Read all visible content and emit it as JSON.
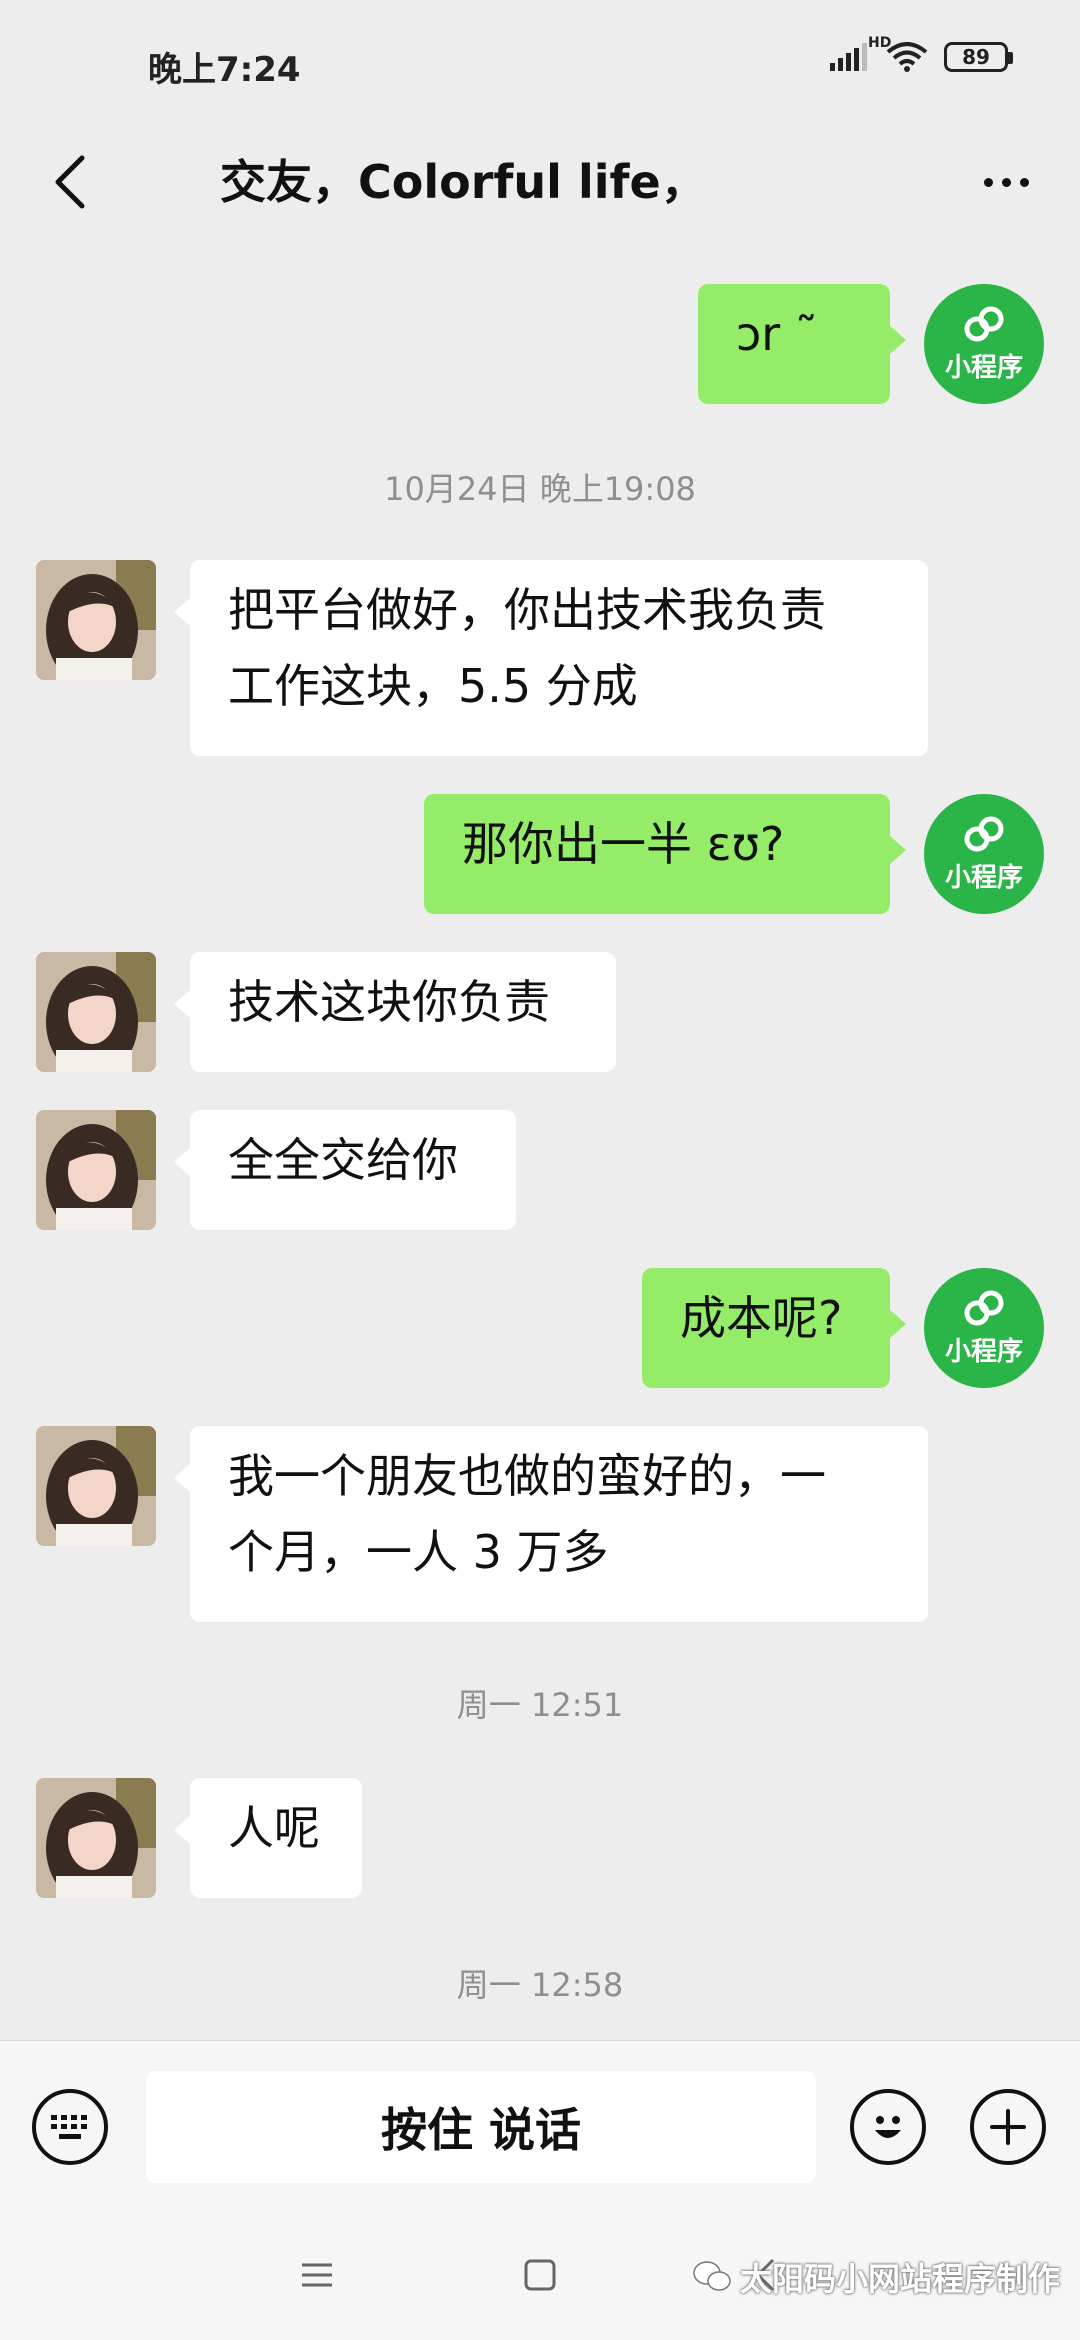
{
  "status_bar": {
    "time": "晚上7:24",
    "network_label": "HD",
    "battery": "89"
  },
  "header": {
    "title": "交友，Colorful life，"
  },
  "messages": [
    {
      "side": "right",
      "text": "ɔr ˜",
      "mini_program_label": "小程序"
    },
    {
      "side": "left",
      "text_lines": [
        "把平台做好，你出技术我负责",
        "工作这块，5.5 分成"
      ]
    },
    {
      "side": "right",
      "text": "那你出一半        ɛʊ?",
      "mini_program_label": "小程序"
    },
    {
      "side": "left",
      "text": "技术这块你负责"
    },
    {
      "side": "left",
      "text": "全全交给你"
    },
    {
      "side": "right",
      "text": "成本呢?",
      "mini_program_label": "小程序"
    },
    {
      "side": "left",
      "text_lines": [
        "我一个朋友也做的蛮好的，一",
        "个月，一人 3 万多"
      ]
    },
    {
      "side": "left",
      "text": "人呢"
    }
  ],
  "timestamps": [
    "10月24日 晚上19:08",
    "周一 12:51",
    "周一 12:58"
  ],
  "input_bar": {
    "hold_to_talk_label": "按住 说话"
  },
  "watermark": "太阳码小网站程序制作"
}
